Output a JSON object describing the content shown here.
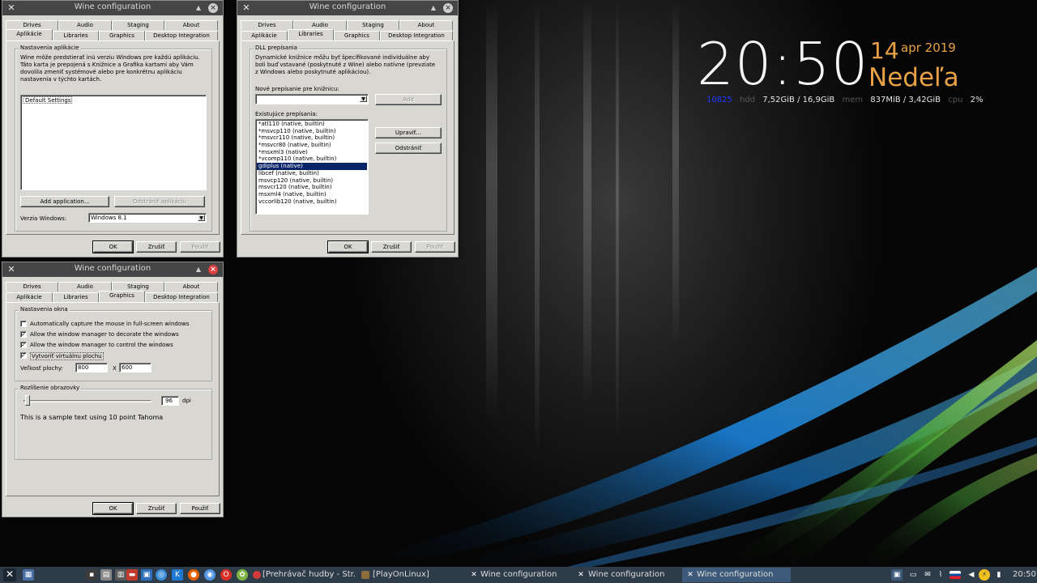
{
  "conky": {
    "time": "20:50",
    "day": "14",
    "month_year": "apr 2019",
    "weekday": "Nedeľa",
    "stats": [
      {
        "key": "10825",
        "value": ""
      },
      {
        "key": "hdd",
        "value": "7,52GiB / 16,9GiB"
      },
      {
        "key": "mem",
        "value": "837MiB / 3,42GiB"
      },
      {
        "key": "cpu",
        "value": "2%"
      }
    ]
  },
  "tabs_top": [
    "Drives",
    "Audio",
    "Staging",
    "About"
  ],
  "tabs_bottom": [
    "Aplikácie",
    "Libraries",
    "Graphics",
    "Desktop Integration"
  ],
  "win_apps": {
    "title": "Wine configuration",
    "group_label": "Nastavenia aplikácie",
    "description": "Wine môže predstierať inú verziu Windows pre každú aplikáciu. Táto karta je prepojená s Knižnice a Grafika kartami aby Vám dovolila zmeniť systémové alebo pre konkrétnu aplikáciu nastavenia v týchto kartách.",
    "list_items": [
      "Default Settings"
    ],
    "add_button": "Add application...",
    "remove_button": "Odstrániť aplikáciu",
    "version_label": "Verzia Windows:",
    "version_value": "Windows 8.1",
    "ok": "OK",
    "cancel": "Zrušiť",
    "apply": "Použiť"
  },
  "win_libs": {
    "title": "Wine configuration",
    "group_label": "DLL prepísania",
    "description": "Dynamické knižnice môžu byť špecifikované individuálne aby boli buď vstavané (poskytnuté z Wine) alebo natívne (prevziate z Windows alebo poskytnuté aplikáciou).",
    "new_override_label": "Nové prepísanie pre knižnicu:",
    "new_override_value": "",
    "add_button": "Add",
    "existing_label": "Existujúce prepísania:",
    "overrides": [
      "*atl110 (native, builtin)",
      "*msvcp110 (native, builtin)",
      "*msvcr110 (native, builtin)",
      "*msvcr80 (native, builtin)",
      "*msxml3 (native)",
      "*vcomp110 (native, builtin)",
      "gdiplus (native)",
      "libcef (native, builtin)",
      "msvcp120 (native, builtin)",
      "msvcr120 (native, builtin)",
      "msxml4 (native, builtin)",
      "vccorlib120 (native, builtin)"
    ],
    "selected_index": 6,
    "edit_button": "Upraviť...",
    "remove_button": "Odstrániť",
    "ok": "OK",
    "cancel": "Zrušiť",
    "apply": "Použiť"
  },
  "win_gfx": {
    "title": "Wine configuration",
    "window_group_label": "Nastavenia okna",
    "checkboxes": [
      {
        "label": "Automatically capture the mouse in full-screen windows",
        "checked": false
      },
      {
        "label": "Allow the window manager to decorate the windows",
        "checked": true
      },
      {
        "label": "Allow the window manager to control the windows",
        "checked": true
      },
      {
        "label": "Vytvoriť virtuálnu plochu",
        "checked": true
      }
    ],
    "desktop_size_label": "Veľkosť plochy:",
    "width": "800",
    "x_label": "X",
    "height": "600",
    "resolution_group_label": "Rozlíšenie obrazovky",
    "dpi_value": "96",
    "dpi_unit": "dpi",
    "sample_text": "This is a sample text using 10 point Tahoma",
    "ok": "OK",
    "cancel": "Zrušiť",
    "apply": "Použiť"
  },
  "taskbar": {
    "tasks": [
      "[Prehrávač hudby - Str...",
      "[PlayOnLinux]",
      "Wine configuration",
      "Wine configuration",
      "Wine configuration"
    ],
    "clock": "20:50"
  }
}
